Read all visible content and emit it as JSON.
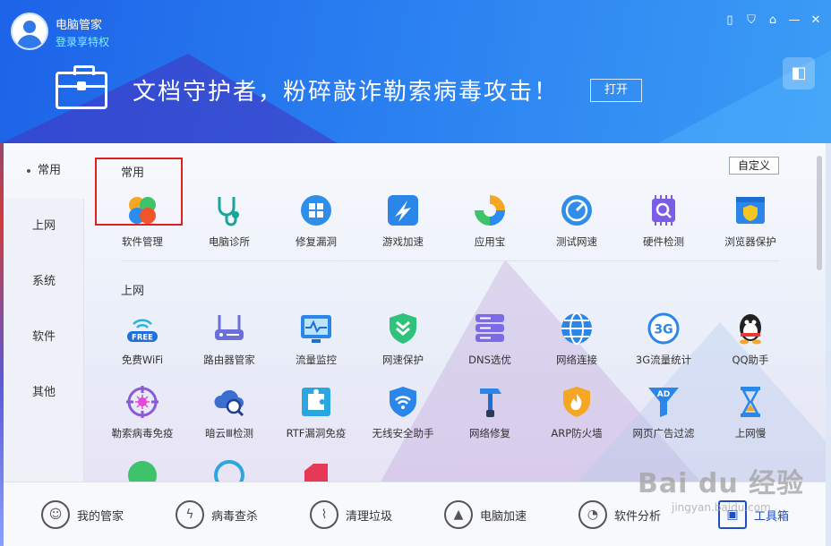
{
  "header": {
    "app_title": "电脑管家",
    "login_link": "登录享特权",
    "banner_text": "文档守护者，粉碎敲诈勒索病毒攻击！",
    "open_button": "打开",
    "window_icons": [
      "phone-icon",
      "shield-icon",
      "shirt-icon",
      "minimize-icon",
      "close-icon"
    ]
  },
  "sidenav": [
    {
      "label": "常用",
      "active": true
    },
    {
      "label": "上网"
    },
    {
      "label": "系统"
    },
    {
      "label": "软件"
    },
    {
      "label": "其他"
    }
  ],
  "sections": {
    "common_title": "常用",
    "network_title": "上网",
    "customize_button": "自定义"
  },
  "common_tools": [
    {
      "label": "软件管理",
      "icon": "clover-icon"
    },
    {
      "label": "电脑诊所",
      "icon": "stethoscope-icon"
    },
    {
      "label": "修复漏洞",
      "icon": "windows-repair-icon"
    },
    {
      "label": "游戏加速",
      "icon": "game-boost-icon"
    },
    {
      "label": "应用宝",
      "icon": "app-store-icon"
    },
    {
      "label": "测试网速",
      "icon": "speedometer-icon"
    },
    {
      "label": "硬件检测",
      "icon": "chip-icon"
    },
    {
      "label": "浏览器保护",
      "icon": "browser-shield-icon"
    }
  ],
  "network_tools_row1": [
    {
      "label": "免费WiFi",
      "icon": "free-wifi-icon"
    },
    {
      "label": "路由器管家",
      "icon": "router-icon"
    },
    {
      "label": "流量监控",
      "icon": "traffic-monitor-icon"
    },
    {
      "label": "网速保护",
      "icon": "speed-shield-icon"
    },
    {
      "label": "DNS选优",
      "icon": "dns-server-icon"
    },
    {
      "label": "网络连接",
      "icon": "globe-icon"
    },
    {
      "label": "3G流量统计",
      "icon": "3g-icon"
    },
    {
      "label": "QQ助手",
      "icon": "qq-penguin-icon"
    }
  ],
  "network_tools_row2": [
    {
      "label": "勒索病毒免疫",
      "icon": "virus-target-icon"
    },
    {
      "label": "暗云Ⅲ检测",
      "icon": "cloud-scan-icon"
    },
    {
      "label": "RTF漏洞免疫",
      "icon": "puzzle-icon"
    },
    {
      "label": "无线安全助手",
      "icon": "wifi-shield-icon"
    },
    {
      "label": "网络修复",
      "icon": "hammer-icon"
    },
    {
      "label": "ARP防火墙",
      "icon": "firewall-icon"
    },
    {
      "label": "网页广告过滤",
      "icon": "ad-filter-icon"
    },
    {
      "label": "上网慢",
      "icon": "hourglass-icon"
    }
  ],
  "bottom_nav": [
    {
      "label": "我的管家",
      "icon": "person-icon"
    },
    {
      "label": "病毒查杀",
      "icon": "lightning-icon"
    },
    {
      "label": "清理垃圾",
      "icon": "broom-icon"
    },
    {
      "label": "电脑加速",
      "icon": "rocket-icon"
    },
    {
      "label": "软件分析",
      "icon": "chart-icon"
    },
    {
      "label": "工具箱",
      "icon": "toolbox-icon",
      "active": true
    }
  ],
  "watermark": {
    "main": "Bai du 经验",
    "sub": "jingyan.baidu.com"
  },
  "colors": {
    "header_blue": "#1d63e8",
    "accent": "#1f4fbf",
    "highlight_red": "#e02020"
  }
}
